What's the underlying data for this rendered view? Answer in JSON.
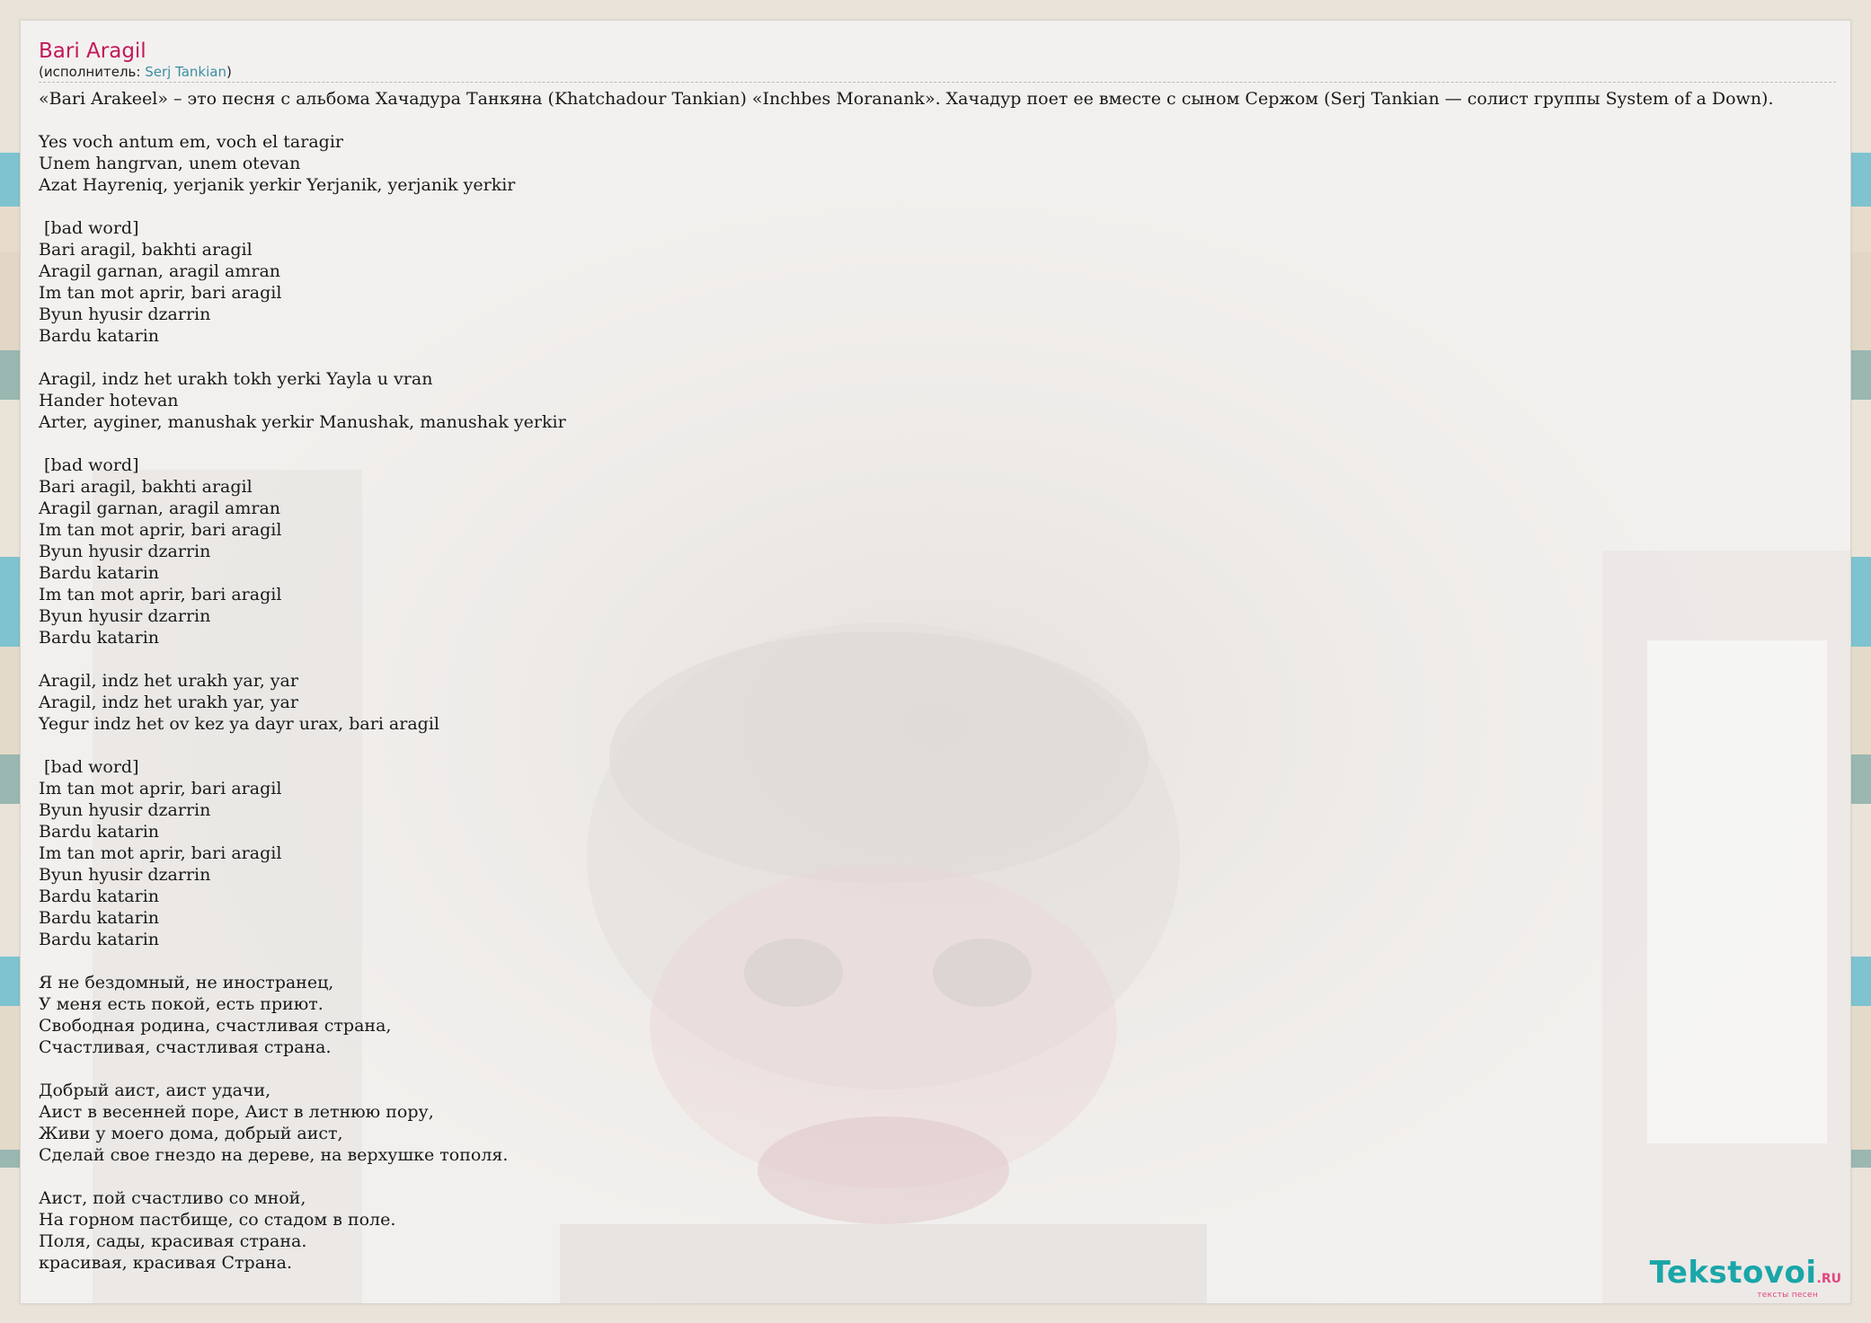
{
  "song": {
    "title": "Bari Aragil",
    "performer_prefix": "(исполнитель: ",
    "performer_name": "Serj Tankian",
    "performer_suffix": ")"
  },
  "intro": "«Bari Arakeel» – это песня с альбома Хачадура Танкяна (Khatchadour Tankian) «Inchbes Moranank». Хачадур поет ее вместе с сыном Сержом (Serj Tankian — солист группы System of a Down).",
  "lyrics": {
    "stanzas": [
      [
        "Yes voch antum em, voch el taragir",
        "Unem hangrvan, unem otevan",
        "Azat Hayreniq, yerjanik yerkir Yerjanik, yerjanik yerkir"
      ],
      [
        " [bad word]",
        "Bari aragil, bakhti aragil",
        "Aragil garnan, aragil amran",
        "Im tan mot aprir, bari aragil",
        "Byun hyusir dzarrin",
        "Bardu katarin"
      ],
      [
        "Aragil, indz het urakh tokh yerki Yayla u vran",
        "Hander hotevan",
        "Arter, ayginer, manushak yerkir Manushak, manushak yerkir"
      ],
      [
        " [bad word]",
        "Bari aragil, bakhti aragil",
        "Aragil garnan, aragil amran",
        "Im tan mot aprir, bari aragil",
        "Byun hyusir dzarrin",
        "Bardu katarin",
        "Im tan mot aprir, bari aragil",
        "Byun hyusir dzarrin",
        "Bardu katarin"
      ],
      [
        "Aragil, indz het urakh yar, yar",
        "Aragil, indz het urakh yar, yar",
        "Yegur indz het ov kez ya dayr urax, bari aragil"
      ],
      [
        " [bad word]",
        "Im tan mot aprir, bari aragil",
        "Byun hyusir dzarrin",
        "Bardu katarin",
        "Im tan mot aprir, bari aragil",
        "Byun hyusir dzarrin",
        "Bardu katarin",
        "Bardu katarin",
        "Bardu katarin"
      ],
      [
        "Я не бездомный, не иностранец,",
        "У меня есть покой, есть приют.",
        "Свободная родина, счастливая страна,",
        "Счастливая, счастливая страна."
      ],
      [
        "Добрый аист, аист удачи,",
        "Аист в весенней поре, Аист в летнюю пору,",
        "Живи у моего дома, добрый аист,",
        "Сделай свое гнездо на дереве, на верхушке тополя."
      ],
      [
        "Аист, пой счастливо со мной,",
        "На горном пастбище, со стадом в поле.",
        "Поля, сады, красивая страна.",
        "красивая, красивая Страна."
      ]
    ]
  },
  "logo": {
    "name": "Tekstovoi",
    "tld": ".RU",
    "tagline": "тексты песен"
  },
  "colors": {
    "title": "#c2185b",
    "link": "#3a8fa3",
    "logo_main": "#1aa6a8",
    "logo_accent": "#e2457e"
  }
}
